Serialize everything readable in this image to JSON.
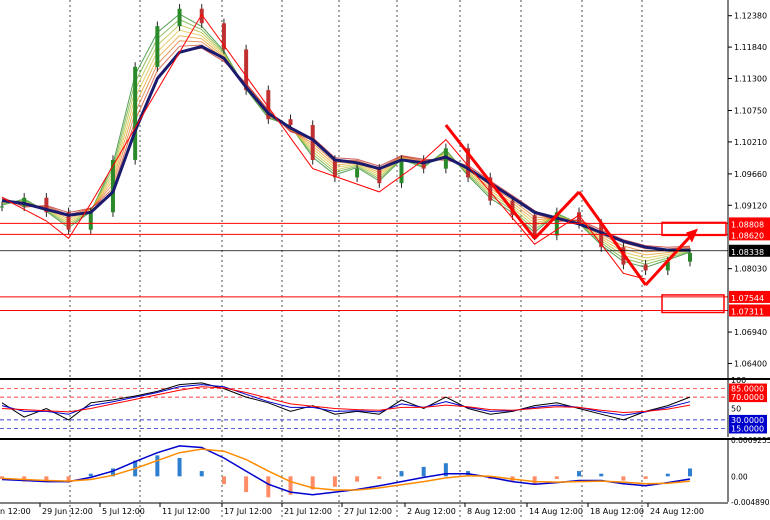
{
  "chart_data": [
    {
      "type": "line",
      "panel": "price",
      "title": "",
      "y_ticks": [
        "1.12380",
        "1.11840",
        "1.11300",
        "1.10750",
        "1.10210",
        "1.09660",
        "1.09120",
        "1.08030",
        "1.06940",
        "1.06400"
      ],
      "ylim": [
        1.0615,
        1.1265
      ],
      "price_series": {
        "name": "",
        "x": [
          "28 Jun 00:00",
          "29 Jun 12:00",
          "1 Jul 00:00",
          "5 Jul 12:00",
          "7 Jul 00:00",
          "9 Jul 12:00",
          "11 Jul 12:00",
          "13 Jul 00:00",
          "15 Jul 12:00",
          "17 Jul 12:00",
          "19 Jul 00:00",
          "21 Jul 12:00",
          "23 Jul 12:00",
          "25 Jul 00:00",
          "27 Jul 12:00",
          "29 Jul 00:00",
          "31 Jul 12:00",
          "2 Aug 12:00",
          "4 Aug 12:00",
          "6 Aug 12:00",
          "8 Aug 12:00",
          "10 Aug 12:00",
          "12 Aug 12:00",
          "14 Aug 12:00",
          "16 Aug 12:00",
          "17 Aug 12:00",
          "18 Aug 12:00",
          "20 Aug 00:00",
          "21 Aug 00:00",
          "22 Aug 12:00",
          "24 Aug 12:00",
          "26 Aug 00:00"
        ],
        "y": [
          1.091,
          1.0925,
          1.09,
          1.087,
          1.09,
          1.099,
          1.115,
          1.122,
          1.125,
          1.1225,
          1.118,
          1.111,
          1.106,
          1.105,
          1.099,
          1.096,
          1.0975,
          1.095,
          1.099,
          1.0975,
          1.101,
          1.096,
          1.092,
          1.0895,
          1.086,
          1.09,
          1.088,
          1.084,
          1.081,
          1.08,
          1.0815,
          1.083
        ]
      },
      "ma_series": {
        "name": "",
        "y": [
          1.092,
          1.0915,
          1.0905,
          1.0895,
          1.09,
          1.0935,
          1.104,
          1.113,
          1.1175,
          1.1185,
          1.1165,
          1.1115,
          1.107,
          1.1045,
          1.1025,
          1.099,
          1.0985,
          1.0975,
          1.099,
          1.0985,
          1.0995,
          1.0975,
          1.095,
          1.0925,
          1.09,
          1.089,
          1.088,
          1.0865,
          1.085,
          1.084,
          1.0835,
          1.0835
        ]
      },
      "h_levels": [
        {
          "value": 1.08808,
          "label": "1.08808",
          "color": "#ff0000"
        },
        {
          "value": 1.0862,
          "label": "1.08620",
          "color": "#ff0000"
        },
        {
          "value": 1.08338,
          "label": "1.08338",
          "color": "#000000"
        },
        {
          "value": 1.07544,
          "label": "1.07544",
          "color": "#ff0000"
        },
        {
          "value": 1.07311,
          "label": "1.07311",
          "color": "#ff0000"
        }
      ],
      "annotations": [
        {
          "type": "zigzag",
          "color": "#ff0000"
        },
        {
          "type": "arrows",
          "color": "#ff0000"
        }
      ]
    },
    {
      "type": "line",
      "panel": "oscillator",
      "y_ticks": [
        "100",
        "85.0000",
        "70.0000",
        "50",
        "30.0000",
        "15.0000"
      ],
      "levels": [
        85,
        70,
        30,
        15
      ],
      "ylim": [
        0,
        100
      ],
      "series": [
        {
          "name": "",
          "color": "#000000",
          "values": [
            60,
            35,
            50,
            30,
            60,
            65,
            72,
            80,
            92,
            95,
            85,
            70,
            60,
            45,
            55,
            40,
            45,
            40,
            65,
            50,
            70,
            50,
            40,
            45,
            55,
            60,
            50,
            40,
            30,
            45,
            55,
            70
          ]
        },
        {
          "name": "",
          "color": "#0000cc",
          "values": [
            55,
            45,
            45,
            40,
            55,
            62,
            70,
            78,
            88,
            92,
            88,
            75,
            62,
            52,
            52,
            45,
            46,
            44,
            58,
            52,
            62,
            52,
            45,
            46,
            52,
            56,
            52,
            44,
            38,
            44,
            52,
            62
          ]
        },
        {
          "name": "",
          "color": "#ff0000",
          "values": [
            50,
            48,
            46,
            44,
            50,
            58,
            66,
            74,
            82,
            88,
            86,
            78,
            68,
            58,
            54,
            50,
            48,
            47,
            52,
            52,
            56,
            53,
            48,
            47,
            50,
            53,
            52,
            47,
            43,
            45,
            49,
            56
          ]
        }
      ]
    },
    {
      "type": "bar",
      "panel": "macd",
      "y_ticks": [
        "0.0069255",
        "0.00",
        "-0.0048906"
      ],
      "ylim": [
        -0.0048906,
        0.0069255
      ],
      "histogram": [
        -0.0005,
        -0.001,
        -0.0008,
        -0.0012,
        0.0005,
        0.0015,
        0.003,
        0.004,
        0.0035,
        0.001,
        -0.0015,
        -0.003,
        -0.004,
        -0.0035,
        -0.0025,
        -0.002,
        -0.001,
        -0.0005,
        0.001,
        0.0018,
        0.0025,
        0.001,
        -0.0005,
        -0.001,
        -0.0015,
        -0.0005,
        0.001,
        0.0005,
        -0.0008,
        -0.0005,
        0.0005,
        0.0015
      ],
      "lines": [
        {
          "name": "",
          "color": "#0000cc",
          "values": [
            -0.0006,
            -0.0008,
            -0.001,
            -0.001,
            -0.0002,
            0.001,
            0.0028,
            0.0045,
            0.0058,
            0.0055,
            0.0035,
            0.001,
            -0.0015,
            -0.003,
            -0.0035,
            -0.003,
            -0.0025,
            -0.0018,
            -0.001,
            -0.0002,
            0.0005,
            0.0005,
            -0.0002,
            -0.001,
            -0.0015,
            -0.0012,
            -0.0008,
            -0.0008,
            -0.0014,
            -0.0018,
            -0.0012,
            -0.0005
          ]
        },
        {
          "name": "",
          "color": "#ff8c00",
          "values": [
            -0.0004,
            -0.0006,
            -0.0008,
            -0.0009,
            -0.0006,
            0.0002,
            0.0015,
            0.003,
            0.0045,
            0.0052,
            0.0048,
            0.0032,
            0.001,
            -0.001,
            -0.0022,
            -0.0026,
            -0.0026,
            -0.0022,
            -0.0016,
            -0.001,
            -0.0003,
            0.0001,
            0.0,
            -0.0005,
            -0.001,
            -0.0011,
            -0.001,
            -0.0009,
            -0.0011,
            -0.0014,
            -0.0013,
            -0.0009
          ]
        }
      ]
    }
  ],
  "x_labels": [
    "29 Jun 12:00",
    "5 Jul 12:00",
    "11 Jul 12:00",
    "17 Jul 12:00",
    "21 Jul 12:00",
    "27 Jul 12:00",
    "2 Aug 12:00",
    "8 Aug 12:00",
    "14 Aug 12:00",
    "18 Aug 12:00",
    "24 Aug 12:00"
  ],
  "x_label_left_clip": "n 12:00",
  "colors": {
    "ma": "#1a1a6e",
    "accent": "#ff0000",
    "hist_pos": "#2f7fd0",
    "hist_neg": "#ff8c66",
    "grid": "#000000"
  }
}
